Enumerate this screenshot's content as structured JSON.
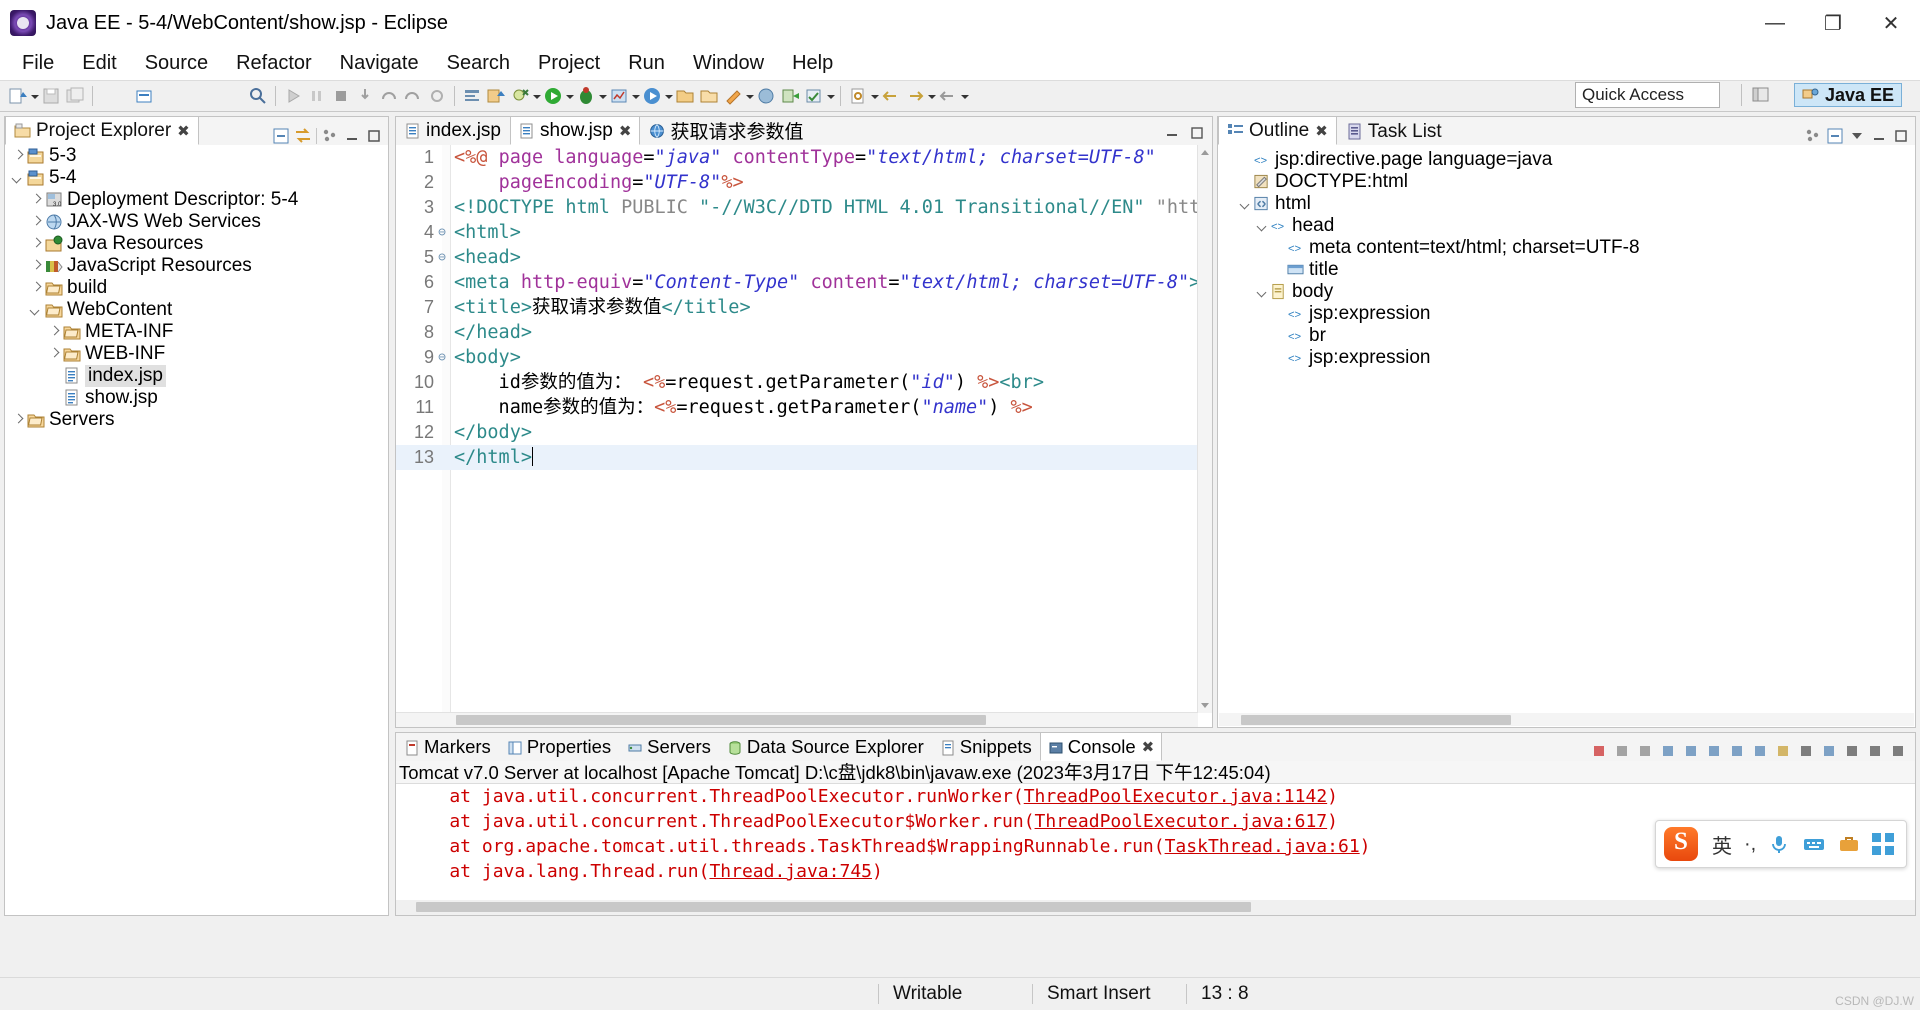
{
  "window": {
    "title": "Java EE - 5-4/WebContent/show.jsp - Eclipse",
    "minimize": "—",
    "maximize": "❐",
    "close": "✕"
  },
  "menubar": {
    "items": [
      "File",
      "Edit",
      "Source",
      "Refactor",
      "Navigate",
      "Search",
      "Project",
      "Run",
      "Window",
      "Help"
    ]
  },
  "toolbar": {
    "quick_access_placeholder": "Quick Access",
    "perspective_label": "Java EE"
  },
  "project_explorer": {
    "tab_label": "Project Explorer",
    "tree": [
      {
        "label": "5-3",
        "indent": 0,
        "twist": "right",
        "icon": "project-icon",
        "selected": false
      },
      {
        "label": "5-4",
        "indent": 0,
        "twist": "down",
        "icon": "project-icon",
        "selected": false
      },
      {
        "label": "Deployment Descriptor: 5-4",
        "indent": 1,
        "twist": "right",
        "icon": "deployment-descriptor-icon",
        "selected": false
      },
      {
        "label": "JAX-WS Web Services",
        "indent": 1,
        "twist": "right",
        "icon": "jaxws-icon",
        "selected": false
      },
      {
        "label": "Java Resources",
        "indent": 1,
        "twist": "right",
        "icon": "java-resources-icon",
        "selected": false
      },
      {
        "label": "JavaScript Resources",
        "indent": 1,
        "twist": "right",
        "icon": "javascript-resources-icon",
        "selected": false
      },
      {
        "label": "build",
        "indent": 1,
        "twist": "right",
        "icon": "folder-icon",
        "selected": false
      },
      {
        "label": "WebContent",
        "indent": 1,
        "twist": "down",
        "icon": "folder-icon",
        "selected": false
      },
      {
        "label": "META-INF",
        "indent": 2,
        "twist": "right",
        "icon": "folder-icon",
        "selected": false
      },
      {
        "label": "WEB-INF",
        "indent": 2,
        "twist": "right",
        "icon": "folder-icon",
        "selected": false
      },
      {
        "label": "index.jsp",
        "indent": 2,
        "twist": "none",
        "icon": "jsp-file-icon",
        "selected": true
      },
      {
        "label": "show.jsp",
        "indent": 2,
        "twist": "none",
        "icon": "jsp-file-icon",
        "selected": false
      },
      {
        "label": "Servers",
        "indent": 0,
        "twist": "right",
        "icon": "folder-icon",
        "selected": false
      }
    ]
  },
  "editor": {
    "tabs": [
      {
        "label": "index.jsp",
        "active": false,
        "closable": false,
        "icon": "jsp-file-icon"
      },
      {
        "label": "show.jsp",
        "active": true,
        "closable": true,
        "icon": "jsp-file-icon"
      },
      {
        "label": "获取请求参数值",
        "active": false,
        "closable": false,
        "icon": "browser-icon"
      }
    ],
    "lines": [
      {
        "n": "1",
        "fold": "",
        "tokens": [
          {
            "t": "<%@",
            "c": "dir"
          },
          {
            "t": " ",
            "c": "txt"
          },
          {
            "t": "page",
            "c": "attr"
          },
          {
            "t": " ",
            "c": "txt"
          },
          {
            "t": "language",
            "c": "attr"
          },
          {
            "t": "=",
            "c": "txt"
          },
          {
            "t": "\"java\"",
            "c": "str"
          },
          {
            "t": " ",
            "c": "txt"
          },
          {
            "t": "contentType",
            "c": "attr"
          },
          {
            "t": "=",
            "c": "txt"
          },
          {
            "t": "\"text/html; charset=UTF-8\"",
            "c": "str"
          }
        ]
      },
      {
        "n": "2",
        "fold": "",
        "tokens": [
          {
            "t": "    ",
            "c": "txt"
          },
          {
            "t": "pageEncoding",
            "c": "attr"
          },
          {
            "t": "=",
            "c": "txt"
          },
          {
            "t": "\"UTF-8\"",
            "c": "str"
          },
          {
            "t": "%>",
            "c": "dir"
          }
        ]
      },
      {
        "n": "3",
        "fold": "",
        "tokens": [
          {
            "t": "<!DOCTYPE html ",
            "c": "tag"
          },
          {
            "t": "PUBLIC ",
            "c": "dt"
          },
          {
            "t": "\"-//W3C//DTD HTML 4.01 Transitional//EN\"",
            "c": "tag"
          },
          {
            "t": " ",
            "c": "txt"
          },
          {
            "t": "\"http://www.w",
            "c": "dt"
          }
        ]
      },
      {
        "n": "4",
        "fold": "⊖",
        "tokens": [
          {
            "t": "<html>",
            "c": "tag"
          }
        ]
      },
      {
        "n": "5",
        "fold": "⊖",
        "tokens": [
          {
            "t": "<head>",
            "c": "tag"
          }
        ]
      },
      {
        "n": "6",
        "fold": "",
        "tokens": [
          {
            "t": "<meta ",
            "c": "tag"
          },
          {
            "t": "http-equiv",
            "c": "attr"
          },
          {
            "t": "=",
            "c": "txt"
          },
          {
            "t": "\"Content-Type\"",
            "c": "str"
          },
          {
            "t": " ",
            "c": "txt"
          },
          {
            "t": "content",
            "c": "attr"
          },
          {
            "t": "=",
            "c": "txt"
          },
          {
            "t": "\"text/html; charset=UTF-8\"",
            "c": "str"
          },
          {
            "t": ">",
            "c": "tag"
          }
        ]
      },
      {
        "n": "7",
        "fold": "",
        "tokens": [
          {
            "t": "<title>",
            "c": "tag"
          },
          {
            "t": "获取请求参数值",
            "c": "txt"
          },
          {
            "t": "</title>",
            "c": "tag"
          }
        ]
      },
      {
        "n": "8",
        "fold": "",
        "tokens": [
          {
            "t": "</head>",
            "c": "tag"
          }
        ]
      },
      {
        "n": "9",
        "fold": "⊖",
        "tokens": [
          {
            "t": "<body>",
            "c": "tag"
          }
        ]
      },
      {
        "n": "10",
        "fold": "",
        "tokens": [
          {
            "t": "    id参数的值为： ",
            "c": "txt"
          },
          {
            "t": "<%",
            "c": "dir"
          },
          {
            "t": "=request.getParameter(",
            "c": "java"
          },
          {
            "t": "\"id\"",
            "c": "str"
          },
          {
            "t": ") ",
            "c": "java"
          },
          {
            "t": "%>",
            "c": "dir"
          },
          {
            "t": "<br>",
            "c": "tag"
          }
        ]
      },
      {
        "n": "11",
        "fold": "",
        "tokens": [
          {
            "t": "    name参数的值为：",
            "c": "txt"
          },
          {
            "t": "<%",
            "c": "dir"
          },
          {
            "t": "=request.getParameter(",
            "c": "java"
          },
          {
            "t": "\"name\"",
            "c": "str"
          },
          {
            "t": ") ",
            "c": "java"
          },
          {
            "t": "%>",
            "c": "dir"
          }
        ]
      },
      {
        "n": "12",
        "fold": "",
        "tokens": [
          {
            "t": "</body>",
            "c": "tag"
          }
        ]
      },
      {
        "n": "13",
        "fold": "",
        "current": true,
        "tokens": [
          {
            "t": "</html>",
            "c": "tag"
          }
        ]
      }
    ]
  },
  "outline": {
    "tabs": [
      {
        "label": "Outline",
        "active": true,
        "closable": true,
        "icon": "outline-icon"
      },
      {
        "label": "Task List",
        "active": false,
        "closable": false,
        "icon": "tasklist-icon"
      }
    ],
    "tree": [
      {
        "label": "jsp:directive.page language=java",
        "indent": 1,
        "twist": "none",
        "icon": "element-icon"
      },
      {
        "label": "DOCTYPE:html",
        "indent": 1,
        "twist": "none",
        "icon": "doctype-icon"
      },
      {
        "label": "html",
        "indent": 1,
        "twist": "down",
        "icon": "html-icon"
      },
      {
        "label": "head",
        "indent": 2,
        "twist": "down",
        "icon": "element-icon"
      },
      {
        "label": "meta content=text/html; charset=UTF-8",
        "indent": 3,
        "twist": "none",
        "icon": "element-icon"
      },
      {
        "label": "title",
        "indent": 3,
        "twist": "none",
        "icon": "title-icon"
      },
      {
        "label": "body",
        "indent": 2,
        "twist": "down",
        "icon": "body-icon"
      },
      {
        "label": "jsp:expression",
        "indent": 3,
        "twist": "none",
        "icon": "element-icon"
      },
      {
        "label": "br",
        "indent": 3,
        "twist": "none",
        "icon": "element-icon"
      },
      {
        "label": "jsp:expression",
        "indent": 3,
        "twist": "none",
        "icon": "element-icon"
      }
    ]
  },
  "console": {
    "tabs": [
      {
        "label": "Markers",
        "active": false,
        "icon": "markers-icon"
      },
      {
        "label": "Properties",
        "active": false,
        "icon": "properties-icon"
      },
      {
        "label": "Servers",
        "active": false,
        "icon": "servers-icon"
      },
      {
        "label": "Data Source Explorer",
        "active": false,
        "icon": "datasource-icon"
      },
      {
        "label": "Snippets",
        "active": false,
        "icon": "snippets-icon"
      },
      {
        "label": "Console",
        "active": true,
        "icon": "console-icon"
      }
    ],
    "header": "Tomcat v7.0 Server at localhost [Apache Tomcat] D:\\c盘\\jdk8\\bin\\javaw.exe (2023年3月17日 下午12:45:04)",
    "lines": [
      {
        "pre": "    at java.util.concurrent.ThreadPoolExecutor.runWorker(",
        "link": "ThreadPoolExecutor.java:1142",
        "post": ")"
      },
      {
        "pre": "    at java.util.concurrent.ThreadPoolExecutor$Worker.run(",
        "link": "ThreadPoolExecutor.java:617",
        "post": ")"
      },
      {
        "pre": "    at org.apache.tomcat.util.threads.TaskThread$WrappingRunnable.run(",
        "link": "TaskThread.java:61",
        "post": ")"
      },
      {
        "pre": "    at java.lang.Thread.run(",
        "link": "Thread.java:745",
        "post": ")"
      }
    ]
  },
  "statusbar": {
    "writable": "Writable",
    "insert_mode": "Smart Insert",
    "position": "13 : 8"
  },
  "ime": {
    "language": "英",
    "punctuation": "·,",
    "mic": "mic-icon",
    "keyboard": "keyboard-icon",
    "toolbox": "toolbox-icon",
    "apps": "apps-icon"
  },
  "watermark": "CSDN @DJ.W",
  "colors": {
    "accent": "#cde6f7",
    "error_text": "#cc0000",
    "string": "#3333cc",
    "tag": "#2d8a8a",
    "attribute": "#a0329a",
    "directive": "#c8553d"
  }
}
